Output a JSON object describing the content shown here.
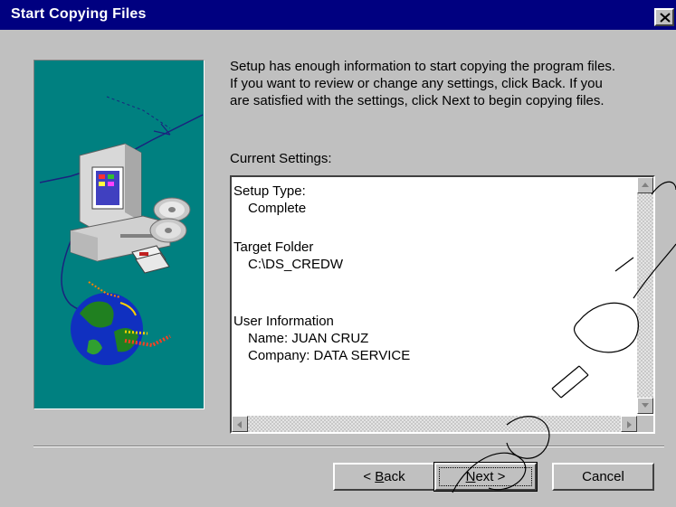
{
  "window": {
    "title": "Start Copying Files",
    "close_icon": "close-icon"
  },
  "intro": {
    "lines": [
      "Setup has enough information to start copying the program files.",
      "If you want to review or change any settings, click Back.  If you",
      "are satisfied with the settings, click Next to begin copying files."
    ]
  },
  "current_settings": {
    "label": "Current Settings:",
    "setup_type_label": "Setup Type:",
    "setup_type_value": "Complete",
    "target_folder_label": "Target Folder",
    "target_folder_value": "C:\\DS_CREDW",
    "user_info_label": "User Information",
    "name_line": "Name:  JUAN CRUZ",
    "company_line": "Company:  DATA SERVICE"
  },
  "buttons": {
    "back_prefix": "< ",
    "back_accel": "B",
    "back_rest": "ack",
    "next_accel": "N",
    "next_rest": "ext >",
    "cancel": "Cancel"
  },
  "colors": {
    "title_bar": "#000080",
    "dialog_face": "#c0c0c0",
    "illustration_bg": "#008080"
  }
}
